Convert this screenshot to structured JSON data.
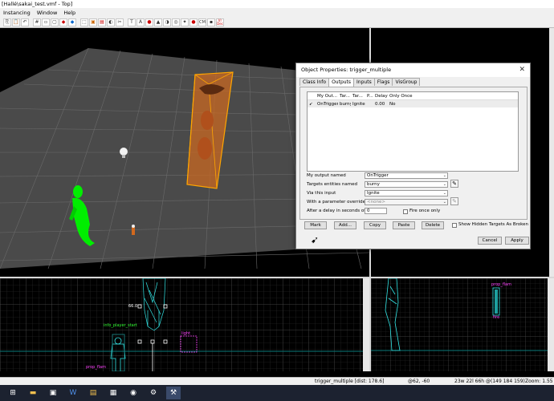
{
  "window": {
    "title": "[Hallé\\sakai_test.vmf - Top]"
  },
  "menu": [
    "Instancing",
    "Window",
    "Help"
  ],
  "toolbar": {
    "cm_label": "CM",
    "mode_label": "Vr\nDec"
  },
  "viewports": {
    "side_labels": {
      "ruler": "66.0",
      "player_start": "info_player_start",
      "light": "light",
      "prop": "prop_flam"
    },
    "front_labels": {
      "prop": "prop_flam",
      "fire": "fire"
    }
  },
  "dialog": {
    "title": "Object Properties: trigger_multiple",
    "tabs": [
      "Class Info",
      "Outputs",
      "Inputs",
      "Flags",
      "VisGroup"
    ],
    "active_tab": "Outputs",
    "columns": [
      "",
      "My Out...",
      "Tar...",
      "Tar...",
      "P...",
      "Delay",
      "Only Once"
    ],
    "rows": [
      {
        "icon": "➹",
        "output": "OnTrigger",
        "target": "burny",
        "input": "Ignite",
        "param": "",
        "delay": "0.00",
        "once": "No"
      }
    ],
    "fields": {
      "output_label": "My output named",
      "output_value": "OnTrigger",
      "targets_label": "Targets entities named",
      "targets_value": "burny",
      "via_label": "Via this input",
      "via_value": "Ignite",
      "param_label": "With a parameter override of",
      "param_value": "<none>",
      "delay_label": "After a delay in seconds of",
      "delay_value": "0",
      "fire_once_label": "Fire once only"
    },
    "buttons": {
      "mark": "Mark",
      "add": "Add...",
      "copy": "Copy",
      "paste": "Paste",
      "delete": "Delete",
      "show_hidden": "Show Hidden Targets As Broken",
      "cancel": "Cancel",
      "apply": "Apply"
    }
  },
  "status": {
    "selection": "trigger_multiple  [dist: 178.6]",
    "coords": "@62, -60",
    "size": "23w 22l 66h @(149 184 159)",
    "zoom": "Zoom: 1.55"
  },
  "colors": {
    "selection": "#ff8c00",
    "player": "#00ee00",
    "wire": "#33e6e6",
    "entity_label": "#ff00ff",
    "grid": "#404040"
  }
}
